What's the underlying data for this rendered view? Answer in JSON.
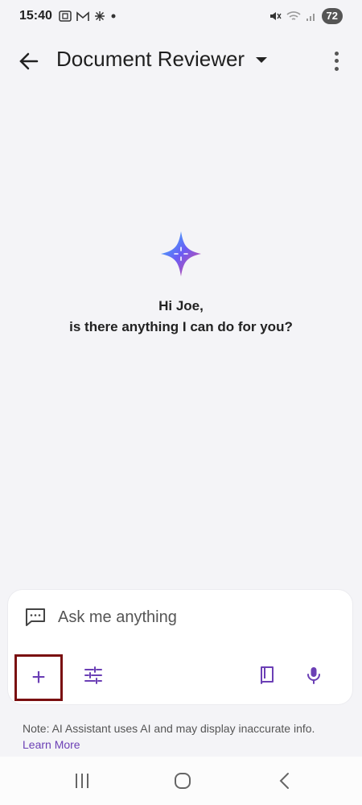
{
  "status_bar": {
    "time": "15:40",
    "battery": "72",
    "left_icons": [
      "screenshot-icon",
      "gmail-icon",
      "pinwheel-icon",
      "dot-icon"
    ],
    "right_icons": [
      "mute-icon",
      "wifi-icon",
      "signal-icon"
    ]
  },
  "app_bar": {
    "title": "Document Reviewer"
  },
  "hero": {
    "greeting_line1": "Hi Joe,",
    "greeting_line2": "is there anything I can do for you?"
  },
  "composer": {
    "placeholder": "Ask me anything",
    "plus_symbol": "+"
  },
  "note": {
    "text": "Note: AI Assistant uses AI and may display inaccurate info.",
    "link": "Learn More"
  },
  "colors": {
    "accent": "#6b3fb5",
    "highlight_border": "#7a0f10",
    "background": "#f4f4f7"
  }
}
